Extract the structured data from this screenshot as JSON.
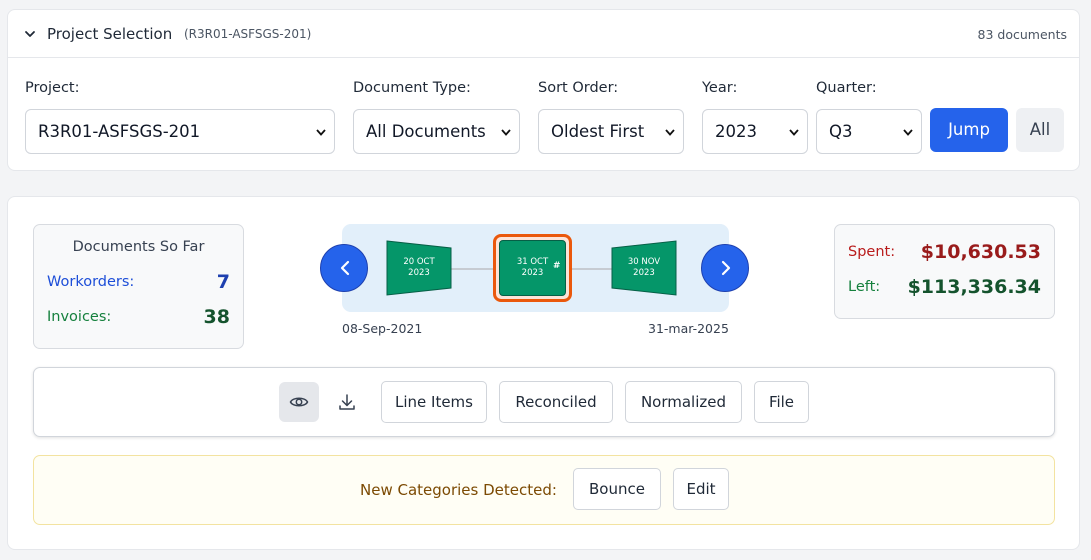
{
  "selection": {
    "title": "Project Selection",
    "code": "(R3R01-ASFSGS-201)",
    "doc_count": "83 documents",
    "fields": {
      "project": {
        "label": "Project:",
        "value": "R3R01-ASFSGS-201"
      },
      "doc_type": {
        "label": "Document Type:",
        "value": "All Documents"
      },
      "sort": {
        "label": "Sort Order:",
        "value": "Oldest First"
      },
      "year": {
        "label": "Year:",
        "value": "2023"
      },
      "quarter": {
        "label": "Quarter:",
        "value": "Q3"
      }
    },
    "jump_label": "Jump",
    "all_label": "All"
  },
  "stats": {
    "title": "Documents So Far",
    "workorders_label": "Workorders:",
    "workorders_value": "7",
    "invoices_label": "Invoices:",
    "invoices_value": "38"
  },
  "timeline": {
    "prev_icon": "chevron-left-icon",
    "next_icon": "chevron-right-icon",
    "nodes": [
      {
        "day": "20 OCT",
        "year": "2023"
      },
      {
        "day": "31 OCT",
        "year": "2023",
        "mark": "#"
      },
      {
        "day": "30 NOV",
        "year": "2023"
      }
    ],
    "start_date": "08-Sep-2021",
    "end_date": "31-mar-2025"
  },
  "budget": {
    "spent_label": "Spent:",
    "spent_value": "$10,630.53",
    "left_label": "Left:",
    "left_value": "$113,336.34"
  },
  "toolbar": {
    "view_icon": "eye-icon",
    "download_icon": "download-icon",
    "line_items": "Line Items",
    "reconciled": "Reconciled",
    "normalized": "Normalized",
    "file": "File"
  },
  "alert": {
    "text": "New Categories Detected:",
    "bounce": "Bounce",
    "edit": "Edit"
  },
  "colors": {
    "accent": "#2563eb",
    "node_green": "#059669",
    "active_border": "#ea580c",
    "spent": "#991b1b",
    "left": "#14532d",
    "workorders": "#1d4ed8",
    "invoices": "#15803d"
  }
}
